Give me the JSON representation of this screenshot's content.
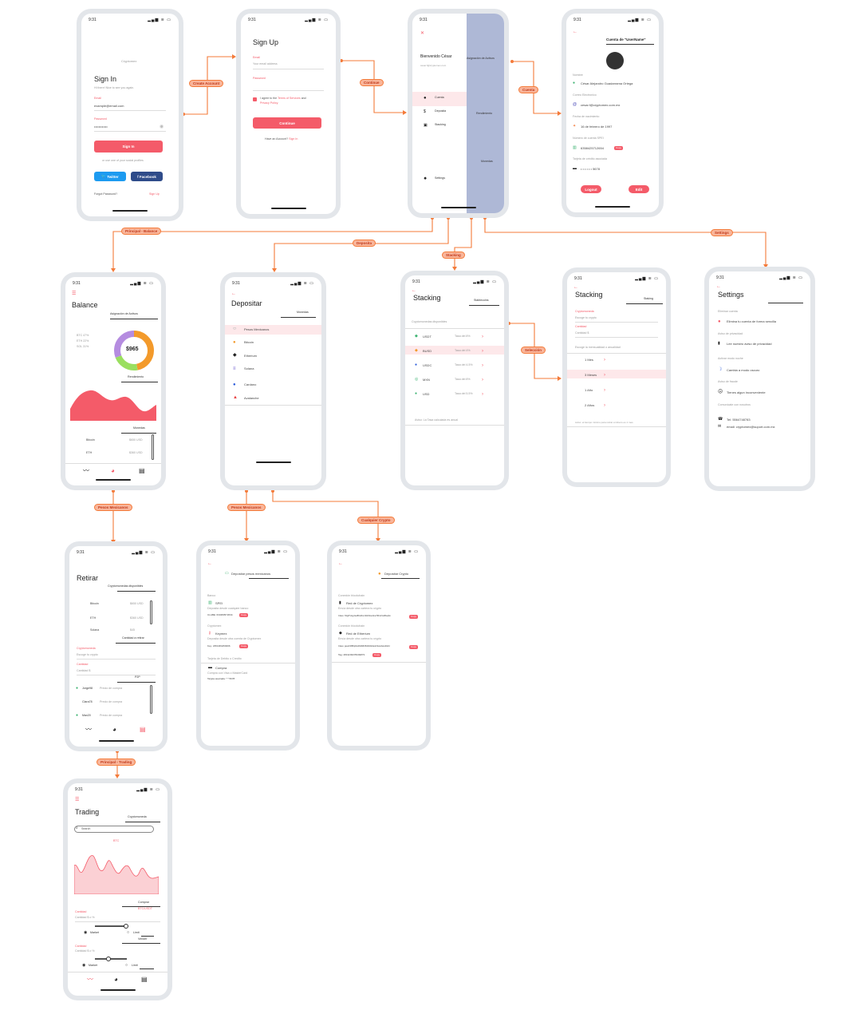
{
  "time": "9:31",
  "status_icons": "▂▄▆ ≋ ▭",
  "labels": {
    "create": "Create Account",
    "continue": "Continue",
    "cuenta": "Cuenta",
    "principal": "Principal - Balance",
    "deposita": "Deposita",
    "stacking": "Stacking",
    "settings": "Settings",
    "seleccion": "Selección",
    "pesos1": "Pesos Mexicanos",
    "pesos2": "Pesos Mexicanos",
    "crypto": "Cualquier Crypto",
    "trading": "Principal - Trading"
  },
  "signin": {
    "brand": "Cryptomex",
    "title": "Sign In",
    "sub": "Hi there! Nice to see you again.",
    "email_lbl": "Email",
    "email_val": "example@email.com",
    "pwd_lbl": "Password",
    "pwd_val": "••••••••••••",
    "btn": "Sign In",
    "or": "or use one of your social profiles",
    "twitter": "Twitter",
    "facebook": "Facebook",
    "forgot": "Forgot Password?",
    "signup": "Sign Up"
  },
  "signup": {
    "title": "Sign Up",
    "email_lbl": "Email",
    "email_ph": "Your email address",
    "pwd_lbl": "Password",
    "agree1": "I agree to the",
    "terms": "Terms of Services",
    "and": "and",
    "privacy": "Privacy Policy.",
    "btn": "Continue",
    "have": "Have an Account?",
    "signin": "Sign In"
  },
  "menu": {
    "welcome": "Bienvenido César",
    "email": "cesar.f@cryptomex.com",
    "items": [
      "Cuenta",
      "Deposita",
      "Stacking"
    ],
    "settings": "Settings",
    "peek1": "Asignación de Activos",
    "peek2": "Rendimiento",
    "peek3": "Monedas"
  },
  "cuenta": {
    "title": "Cuenta de \"UserName\"",
    "f1": "Nombre",
    "v1": "César Alejandro Guadarrama Ortega",
    "f2": "Correo Electronico",
    "v2": "cesar.f@cryptomex.com.mx",
    "f3": "Fecha de nacimiento",
    "v3": "16 de febrero de 1997",
    "f4": "Número de cuenta SPEI",
    "v4": "6358425712654",
    "f5": "Tarjeta de crédito asociada",
    "v5": "• • • • • • 5678",
    "copy": "Copy",
    "logout": "Logout",
    "edit": "Edit"
  },
  "balance": {
    "title": "Balance",
    "tab1": "Asignación de Activos",
    "legend": [
      "BTC 47%",
      "ETH 22%",
      "SOL 31%"
    ],
    "total": "$965",
    "tab2": "Rendimiento",
    "tab3": "Monedas",
    "rows": [
      [
        "Bitcoin",
        "$650 USD"
      ],
      [
        "ETH",
        "$360 USD"
      ]
    ]
  },
  "depositar": {
    "title": "Depositar",
    "tab": "Monedas",
    "items": [
      "Pesos Mexicanos",
      "Bitcoin",
      "Etherium",
      "Solana",
      "Cardano",
      "Avalanche"
    ]
  },
  "stack1": {
    "title": "Stacking",
    "tab": "Stablecoins",
    "sec": "Cryptomonedas disponibles",
    "rows": [
      [
        "USDT",
        "Tasa del 8%"
      ],
      [
        "BUSD",
        "Tasa del 4%"
      ],
      [
        "USDC",
        "Tasa del 4.5%"
      ],
      [
        "MXN",
        "Tasa del 8%"
      ],
      [
        "USD",
        "Tasa del 5.5%"
      ]
    ],
    "note": "Aviso: La Tasa calculada es anual"
  },
  "stack2": {
    "title": "Stacking",
    "tab": "Staking",
    "f1": "Cryptomoneda",
    "p1": "Escoge tu crypto",
    "f2": "Cantidad",
    "p2": "Cantidad $",
    "sec": "Escoge la mensualidad o anualidad",
    "opts": [
      "1 Mes",
      "3 Meses",
      "1 Año",
      "2 Años"
    ],
    "note": "Aviso: el tiempo mínimo para retirar el dinero es 1 mes"
  },
  "settings": {
    "title": "Settings",
    "s1": "Eliminar cuenta",
    "i1": "Elimina tu cuenta de forma sencilla",
    "s2": "Aviso de privacidad",
    "i2": "Lee nuestro aviso de privacidad",
    "s3": "Activar modo noche",
    "i3": "Cambia a modo oscuro",
    "s4": "Aviso de fraude",
    "i4": "Tienes algun inconveniente",
    "s5": "Comunícate con nosotros",
    "tel": "Tel: 5564748783",
    "mail": "email: cryptomex@suport.com.mx"
  },
  "retirar": {
    "title": "Retirar",
    "tab1": "Cryptomonedas disponibles",
    "rows": [
      [
        "Bitcoin",
        "$650 USD"
      ],
      [
        "ETH",
        "$360 USD"
      ],
      [
        "Solana",
        "$45"
      ]
    ],
    "tab2": "Cantidad a retirar",
    "f1": "Cryptomoneda",
    "p1": "Escoge tu crypto",
    "f2": "Cantidad",
    "p2": "Cantidad $",
    "tab3": "P2P",
    "p2p": [
      [
        "Jorge98",
        "Precio de compra"
      ],
      [
        "Clara78",
        "Precio de compra"
      ],
      [
        "Max20",
        "Precio de compra"
      ]
    ]
  },
  "pesos": {
    "title": "Depositar pesos mexicanos",
    "s1": "Banco",
    "t1": "SPEI",
    "d1": "Deposita desde cualquier banco",
    "c1": "CLABE: 633483572634",
    "s2": "Cryptomex",
    "t2": "Keymex",
    "d2": "Deposita desde otra cuenta de Cryptomex",
    "c2": "Key: 2351384459366",
    "s3": "Tarjeta de Debito o Credito",
    "t3": "Compra",
    "d3": "Compra con Visa o MasterCard",
    "c3": "Tarjeta asociada: * * 5678",
    "copy": "Copy"
  },
  "cryp": {
    "title": "Depositar Crypto",
    "s1": "Conexión blockchain",
    "t1": "Red de Cryptomex",
    "d1": "Envía desde otra cartera tu crypto",
    "c1": "Clave: 63gf7HvgJwe8b12kvn34rbbsu0ou79Fs31u8bxqbn",
    "s2": "Conexión blockchain",
    "t2": "Red de Etherium",
    "d2": "Envía desde otra cartera tu crypto",
    "c2": "Clave: jaewh3ff8q03e0hd8dF8d2022desbf1wsdwto2bdd",
    "c3": "Tag: 2813249378249873",
    "copy": "Copy"
  },
  "trading": {
    "title": "Trading",
    "tab": "Cryptomoneda",
    "search": "Search",
    "coin": "BTC",
    "tab2": "Comprar",
    "pair": "BTC/USDT",
    "f1": "Cantidad",
    "p1": "Cantidad $ o %",
    "market": "Market",
    "limit": "Limit",
    "tab3": "Vender",
    "f2": "Cantidad",
    "p2": "Cantidad $ o %"
  },
  "colors": {
    "accent": "#f45b69",
    "orange": "#f47b3a",
    "label_fill": "#f9b59a"
  }
}
